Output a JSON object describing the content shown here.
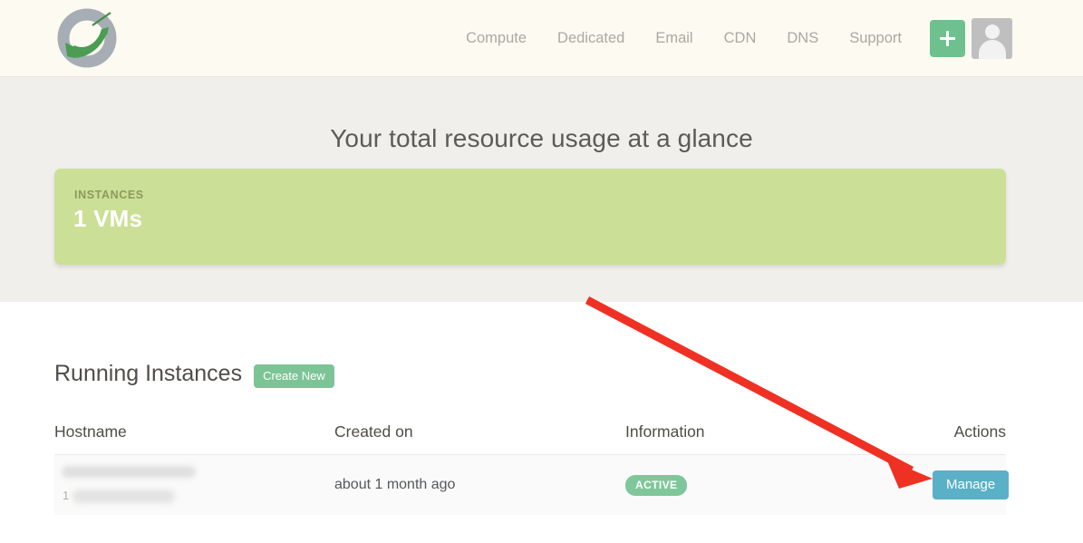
{
  "header": {
    "logo_name": "brand-logo",
    "nav": [
      {
        "label": "Compute"
      },
      {
        "label": "Dedicated"
      },
      {
        "label": "Email"
      },
      {
        "label": "CDN"
      },
      {
        "label": "DNS"
      },
      {
        "label": "Support"
      }
    ],
    "add_button_label": "+",
    "avatar_label": "Account"
  },
  "hero": {
    "title": "Your total resource usage at a glance",
    "card": {
      "label": "INSTANCES",
      "value": "1 VMs"
    }
  },
  "main": {
    "section_title": "Running Instances",
    "create_button_label": "Create New",
    "table": {
      "columns": [
        "Hostname",
        "Created on",
        "Information",
        "Actions"
      ],
      "rows": [
        {
          "index": "1",
          "hostname": "",
          "created_on": "about 1 month ago",
          "status": "ACTIVE",
          "action_label": "Manage"
        }
      ]
    }
  },
  "annotation": {
    "type": "arrow",
    "points_to": "Manage",
    "color": "#ef3124"
  },
  "colors": {
    "header_bg": "#fdfbf1",
    "hero_bg": "#f0efeb",
    "card_green": "#ccdf96",
    "accent_green": "#7cc495",
    "manage_blue": "#5ab0c6",
    "badge_green": "#7fc79a",
    "annotation_red": "#ef3124"
  }
}
